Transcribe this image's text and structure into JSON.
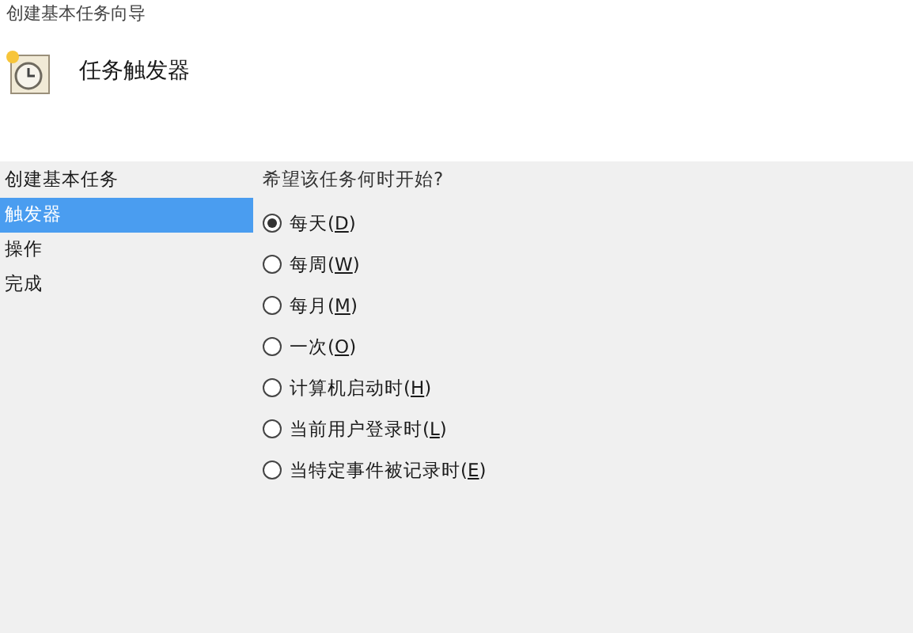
{
  "window": {
    "title": "创建基本任务向导"
  },
  "header": {
    "title": "任务触发器"
  },
  "sidebar": {
    "items": [
      {
        "label": "创建基本任务",
        "selected": false
      },
      {
        "label": "触发器",
        "selected": true
      },
      {
        "label": "操作",
        "selected": false
      },
      {
        "label": "完成",
        "selected": false
      }
    ]
  },
  "question": "希望该任务何时开始?",
  "options": [
    {
      "prefix": "每天(",
      "key": "D",
      "suffix": ")",
      "selected": true
    },
    {
      "prefix": "每周(",
      "key": "W",
      "suffix": ")",
      "selected": false
    },
    {
      "prefix": "每月(",
      "key": "M",
      "suffix": ")",
      "selected": false
    },
    {
      "prefix": "一次(",
      "key": "O",
      "suffix": ")",
      "selected": false
    },
    {
      "prefix": "计算机启动时(",
      "key": "H",
      "suffix": ")",
      "selected": false
    },
    {
      "prefix": "当前用户登录时(",
      "key": "L",
      "suffix": ")",
      "selected": false
    },
    {
      "prefix": "当特定事件被记录时(",
      "key": "E",
      "suffix": ")",
      "selected": false
    }
  ]
}
